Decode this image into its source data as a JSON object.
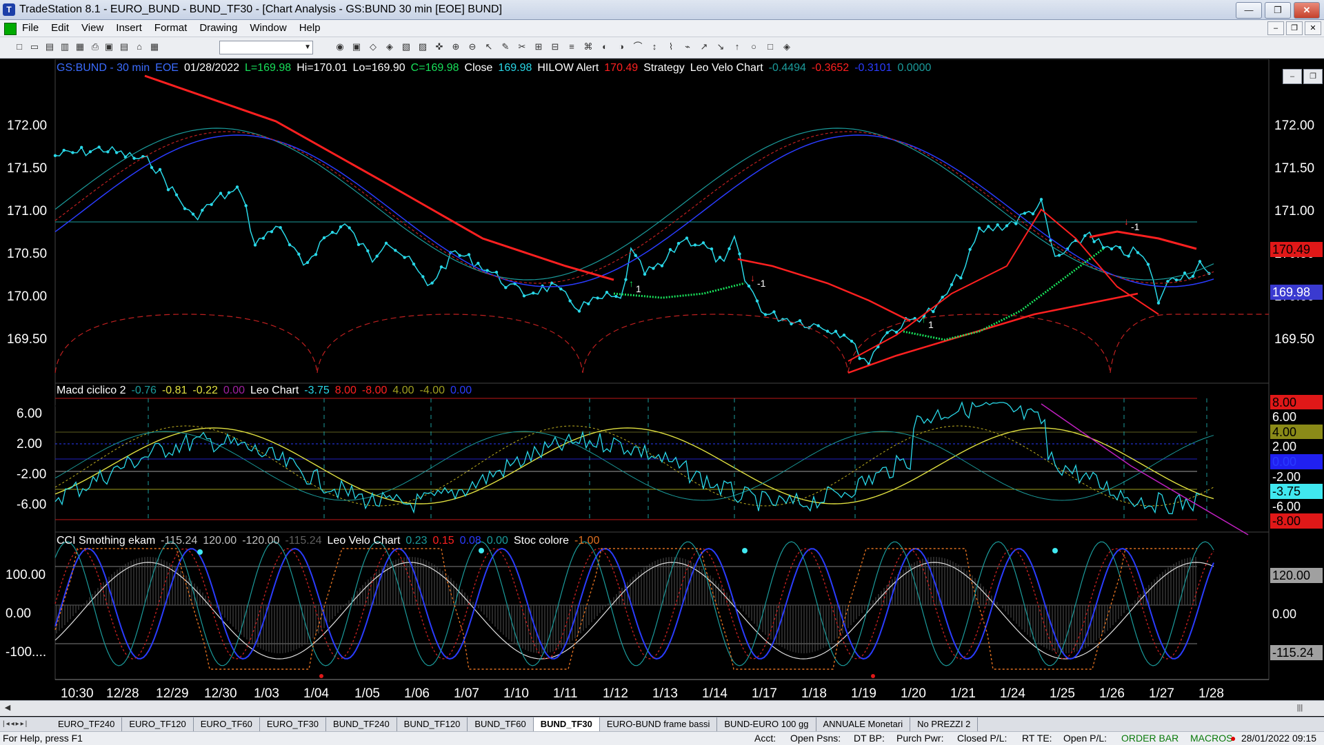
{
  "window": {
    "title": "TradeStation 8.1 - EURO_BUND - BUND_TF30 - [Chart Analysis - GS:BUND  30 min  [EOE] BUND]",
    "app_icon": "tradestation-icon"
  },
  "menu": [
    "File",
    "Edit",
    "View",
    "Insert",
    "Format",
    "Drawing",
    "Window",
    "Help"
  ],
  "toolbar": {
    "symbol_combo_value": ""
  },
  "chart": {
    "header1": [
      {
        "text": "GS:BUND - 30 min",
        "color": "#3b6cff"
      },
      {
        "text": "EOE",
        "color": "#3b6cff"
      },
      {
        "text": "01/28/2022",
        "color": "#ffffff"
      },
      {
        "text": "L=169.98",
        "color": "#18e05a"
      },
      {
        "text": "Hi=170.01",
        "color": "#ffffff"
      },
      {
        "text": "Lo=169.90",
        "color": "#ffffff"
      },
      {
        "text": "C=169.98",
        "color": "#18e05a"
      },
      {
        "text": "Close",
        "color": "#ffffff"
      },
      {
        "text": "169.98",
        "color": "#29d8e8"
      },
      {
        "text": "HILOW Alert",
        "color": "#ffffff"
      },
      {
        "text": "170.49",
        "color": "#ff2020"
      },
      {
        "text": "Strategy",
        "color": "#ffffff"
      },
      {
        "text": "Leo Velo Chart",
        "color": "#ffffff"
      },
      {
        "text": "-0.4494",
        "color": "#1b9c9c"
      },
      {
        "text": "-0.3652",
        "color": "#ff2020"
      },
      {
        "text": "-0.3101",
        "color": "#2a3cff"
      },
      {
        "text": "0.0000",
        "color": "#1b9c9c"
      }
    ],
    "header2": [
      {
        "text": "Macd ciclico 2",
        "color": "#ffffff"
      },
      {
        "text": "-0.76",
        "color": "#1b9c9c"
      },
      {
        "text": "-0.81",
        "color": "#e0e040"
      },
      {
        "text": "-0.22",
        "color": "#e0e040"
      },
      {
        "text": "0.00",
        "color": "#a020a0"
      },
      {
        "text": "Leo Chart",
        "color": "#ffffff"
      },
      {
        "text": "-3.75",
        "color": "#29d8e8"
      },
      {
        "text": "8.00",
        "color": "#ff2020"
      },
      {
        "text": "-8.00",
        "color": "#ff2020"
      },
      {
        "text": "4.00",
        "color": "#a0a020"
      },
      {
        "text": "-4.00",
        "color": "#a0a020"
      },
      {
        "text": "0.00",
        "color": "#2a3cff"
      }
    ],
    "header3": [
      {
        "text": "CCI Smothing ekam",
        "color": "#ffffff"
      },
      {
        "text": "-115.24",
        "color": "#c0c0c0"
      },
      {
        "text": "120.00",
        "color": "#c0c0c0"
      },
      {
        "text": "-120.00",
        "color": "#c0c0c0"
      },
      {
        "text": "-115.24",
        "color": "#606060"
      },
      {
        "text": "Leo Velo Chart",
        "color": "#ffffff"
      },
      {
        "text": "0.23",
        "color": "#1b9c9c"
      },
      {
        "text": "0.15",
        "color": "#ff2020"
      },
      {
        "text": "0.08",
        "color": "#2a3cff"
      },
      {
        "text": "0.00",
        "color": "#1b9c9c"
      },
      {
        "text": "Stoc colore",
        "color": "#ffffff"
      },
      {
        "text": "-1.00",
        "color": "#e07020"
      }
    ],
    "price_axis": [
      "172.00",
      "171.50",
      "171.00",
      "170.50",
      "170.00",
      "169.50"
    ],
    "macd_axis": [
      "6.00",
      "2.00",
      "-2.00",
      "-6.00"
    ],
    "cci_axis": [
      "100.00",
      "0.00",
      "-100...."
    ],
    "x_labels": [
      "10:30",
      "12/28",
      "12/29",
      "12/30",
      "1/03",
      "1/04",
      "1/05",
      "1/06",
      "1/07",
      "1/10",
      "1/11",
      "1/12",
      "1/13",
      "1/14",
      "1/17",
      "1/18",
      "1/19",
      "1/20",
      "1/21",
      "1/24",
      "1/25",
      "1/26",
      "1/27",
      "1/28"
    ],
    "price_tags": [
      {
        "text": "170.49",
        "bg": "#e01818",
        "fg": "#000000"
      },
      {
        "text": "169.98",
        "bg": "#3a3ad0",
        "fg": "#ffffff"
      }
    ],
    "macd_tags": [
      {
        "text": "8.00",
        "bg": "#e01818",
        "fg": "#000000"
      },
      {
        "text": "6.00",
        "bg": "#000000",
        "fg": "#ffffff"
      },
      {
        "text": "4.00",
        "bg": "#8a8a18",
        "fg": "#000000"
      },
      {
        "text": "2.00",
        "bg": "#000000",
        "fg": "#ffffff"
      },
      {
        "text": "0.00",
        "bg": "#2020f0",
        "fg": "#2a3cff"
      },
      {
        "text": "-2.00",
        "bg": "#000000",
        "fg": "#ffffff"
      },
      {
        "text": "-3.75",
        "bg": "#40e8f0",
        "fg": "#000000"
      },
      {
        "text": "-6.00",
        "bg": "#000000",
        "fg": "#ffffff"
      },
      {
        "text": "-8.00",
        "bg": "#e01818",
        "fg": "#000000"
      }
    ],
    "cci_tags": [
      {
        "text": "120.00",
        "bg": "#a0a0a0",
        "fg": "#000000"
      },
      {
        "text": "0.00",
        "bg": "#000000",
        "fg": "#ffffff"
      },
      {
        "text": "-115.24",
        "bg": "#a0a0a0",
        "fg": "#000000"
      }
    ],
    "signal_labels": [
      "1",
      "-1",
      "1",
      "-1"
    ],
    "colors": {
      "price": "#29d8e8",
      "trend": "#ff2020",
      "support": "#18e05a",
      "fast": "#2a3cff",
      "osc_yellow": "#e0e040",
      "magenta": "#c020c0"
    }
  },
  "tabs": [
    "EURO_TF240",
    "EURO_TF120",
    "EURO_TF60",
    "EURO_TF30",
    "BUND_TF240",
    "BUND_TF120",
    "BUND_TF60",
    "BUND_TF30",
    "EURO-BUND frame bassi",
    "BUND-EURO 100 gg",
    "ANNUALE Monetari",
    "No PREZZI 2"
  ],
  "active_tab": "BUND_TF30",
  "status": {
    "help": "For Help, press F1",
    "acct": "Acct:",
    "open_psns": "Open Psns:",
    "dt_bp": "DT BP:",
    "purch_pwr": "Purch Pwr:",
    "closed_pl": "Closed P/L:",
    "rt_te": "RT TE:",
    "open_pl": "Open P/L:",
    "order_bar": "ORDER BAR",
    "macros": "MACROS",
    "datetime": "28/01/2022 09:15"
  }
}
